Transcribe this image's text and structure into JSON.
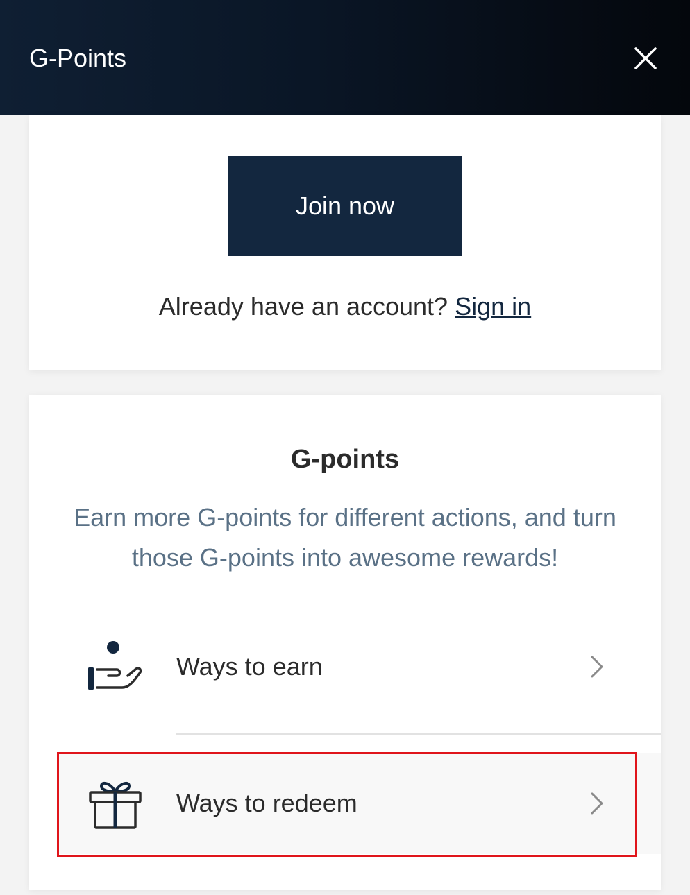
{
  "header": {
    "title": "G-Points",
    "close_icon": "close-icon"
  },
  "account": {
    "join_label": "Join now",
    "prompt": "Already have an account?",
    "signin_label": "Sign in"
  },
  "points": {
    "title": "G-points",
    "description": "Earn more G-points for different actions, and turn those G-points into awesome rewards!",
    "items": [
      {
        "label": "Ways to earn",
        "icon": "hand-coin-icon"
      },
      {
        "label": "Ways to redeem",
        "icon": "gift-icon",
        "highlighted": true
      }
    ]
  },
  "colors": {
    "header_bg": "#0c1a2b",
    "primary": "#13273f",
    "description_text": "#5a7186",
    "highlight": "#e0151b"
  }
}
